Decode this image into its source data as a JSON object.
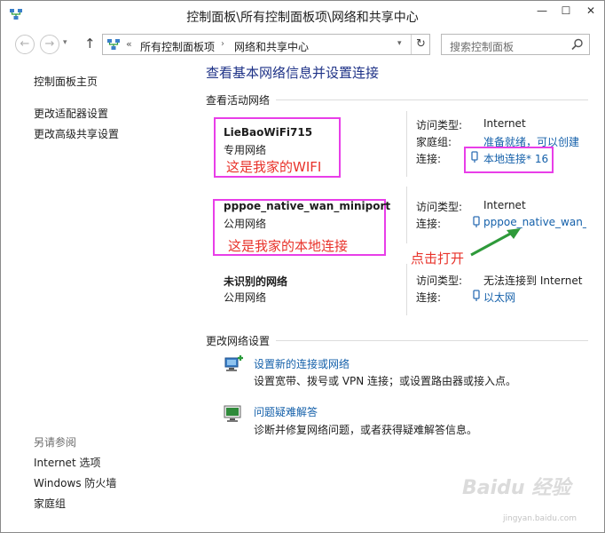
{
  "window": {
    "title": "控制面板\\所有控制面板项\\网络和共享中心",
    "minimize": "—",
    "maximize": "☐",
    "close": "✕"
  },
  "nav": {
    "back": "←",
    "forward": "→",
    "up": "↑",
    "chevron": "«",
    "breadcrumb": [
      "所有控制面板项",
      "网络和共享中心"
    ],
    "breadcrumb_sep": "›",
    "refresh": "↻",
    "search_placeholder": "搜索控制面板"
  },
  "sidebar": {
    "home": "控制面板主页",
    "items": [
      "更改适配器设置",
      "更改高级共享设置"
    ],
    "see_also_title": "另请参阅",
    "see_also": [
      "Internet 选项",
      "Windows 防火墙",
      "家庭组"
    ]
  },
  "main": {
    "title": "查看基本网络信息并设置连接",
    "active_networks_label": "查看活动网络",
    "networks": [
      {
        "name": "LieBaoWiFi715",
        "type": "专用网络",
        "access_label": "访问类型:",
        "access_value": "Internet",
        "homegroup_label": "家庭组:",
        "homegroup_value": "准备就绪，可以创建",
        "connection_label": "连接:",
        "connection_value": "本地连接* 16"
      },
      {
        "name": "pppoe_native_wan_miniport",
        "type": "公用网络",
        "access_label": "访问类型:",
        "access_value": "Internet",
        "connection_label": "连接:",
        "connection_value": "pppoe_native_wan_m"
      },
      {
        "name": "未识别的网络",
        "type": "公用网络",
        "access_label": "访问类型:",
        "access_value": "无法连接到 Internet",
        "connection_label": "连接:",
        "connection_value": "以太网"
      }
    ],
    "change_settings_label": "更改网络设置",
    "tasks": [
      {
        "link": "设置新的连接或网络",
        "desc": "设置宽带、拨号或 VPN 连接；或设置路由器或接入点。"
      },
      {
        "link": "问题疑难解答",
        "desc": "诊断并修复网络问题，或者获得疑难解答信息。"
      }
    ]
  },
  "annotations": {
    "wifi_note": "这是我家的WIFI",
    "local_note": "这是我家的本地连接",
    "click_note": "点击打开",
    "box_color": "#e83ee8",
    "text_color": "#e8322a",
    "arrow_color": "#2e9a3a"
  },
  "watermark": {
    "text": "Baidu 经验",
    "url": "jingyan.baidu.com"
  },
  "colors": {
    "title_blue": "#1e3287",
    "link_blue": "#1460aa"
  }
}
